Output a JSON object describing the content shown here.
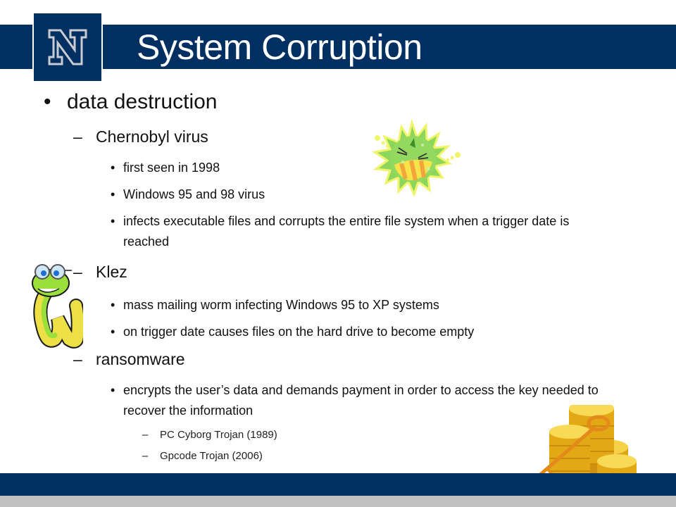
{
  "slide": {
    "title": "System Corruption",
    "logo_letter": "N",
    "colors": {
      "brand_navy": "#002F61",
      "footer_gray": "#C0C0C0",
      "text": "#111111"
    },
    "bullets": {
      "level1": {
        "marker": "•",
        "text": "data destruction"
      },
      "chernobyl": {
        "marker": "–",
        "text": "Chernobyl virus",
        "items": [
          {
            "marker": "•",
            "text": "first seen in 1998"
          },
          {
            "marker": "•",
            "text": "Windows 95 and 98 virus"
          },
          {
            "marker": "•",
            "text": "infects executable files and corrupts the entire file system when a trigger date is reached"
          }
        ]
      },
      "klez": {
        "marker": "–",
        "text": "Klez",
        "items": [
          {
            "marker": "•",
            "text": "mass mailing worm infecting Windows 95 to XP systems"
          },
          {
            "marker": "•",
            "text": "on trigger date causes files on the hard drive to become empty"
          }
        ]
      },
      "ransomware": {
        "marker": "–",
        "text": "ransomware",
        "items": [
          {
            "marker": "•",
            "text": "encrypts the user’s data and demands payment in order to access the key needed to recover the information"
          }
        ],
        "examples": [
          {
            "marker": "–",
            "text": "PC Cyborg Trojan (1989)"
          },
          {
            "marker": "–",
            "text": "Gpcode Trojan (2006)"
          }
        ]
      }
    },
    "illustrations": [
      "virus-germ-icon",
      "worm-with-glasses-icon",
      "key-and-coins-icon"
    ]
  }
}
